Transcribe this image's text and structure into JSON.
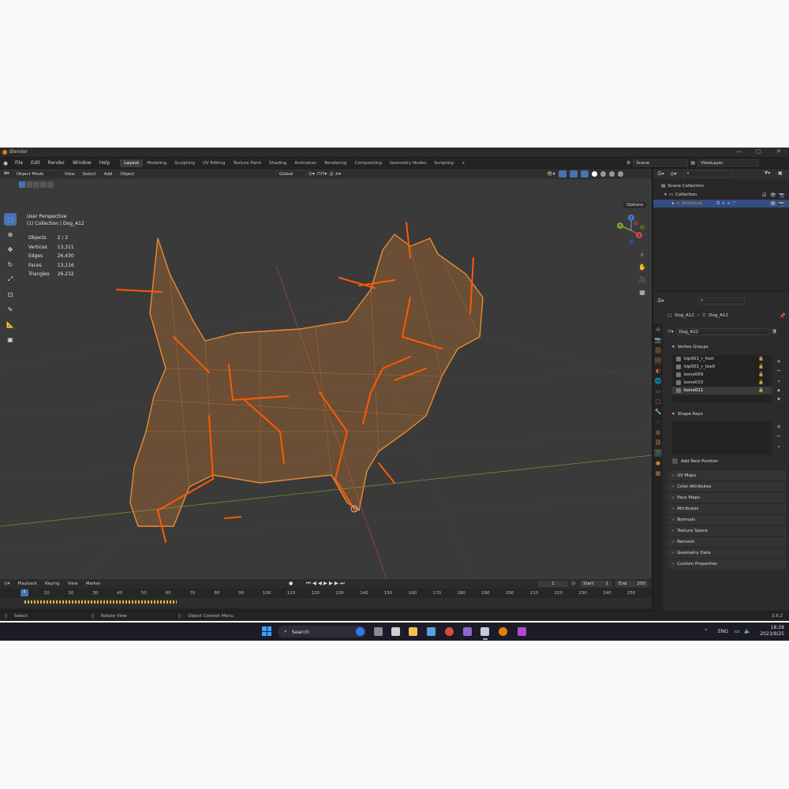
{
  "app": {
    "title": "Blender",
    "version": "3.6.2"
  },
  "menubar": {
    "menus": [
      "File",
      "Edit",
      "Render",
      "Window",
      "Help"
    ],
    "workspaces": [
      "Layout",
      "Modeling",
      "Sculpting",
      "UV Editing",
      "Texture Paint",
      "Shading",
      "Animation",
      "Rendering",
      "Compositing",
      "Geometry Nodes",
      "Scripting"
    ],
    "active_workspace": "Layout",
    "scene": "Scene",
    "view_layer": "ViewLayer"
  },
  "viewport": {
    "mode": "Object Mode",
    "menus": [
      "View",
      "Select",
      "Add",
      "Object"
    ],
    "transform_orientation": "Global",
    "options_label": "Options",
    "perspective": "User Perspective",
    "context": "(1) Collection | Dog_A12",
    "stats": [
      {
        "label": "Objects",
        "value": "2 / 2"
      },
      {
        "label": "Vertices",
        "value": "13,311"
      },
      {
        "label": "Edges",
        "value": "26,430"
      },
      {
        "label": "Faces",
        "value": "13,116"
      },
      {
        "label": "Triangles",
        "value": "26,232"
      }
    ],
    "gizmo": {
      "x": "X",
      "y": "Y",
      "z": "Z"
    }
  },
  "timeline": {
    "menus": [
      "Playback",
      "Keying",
      "View",
      "Marker"
    ],
    "current_frame": "1",
    "start_label": "Start",
    "start": "1",
    "end_label": "End",
    "end": "250",
    "ticks": [
      "1",
      "10",
      "20",
      "30",
      "40",
      "50",
      "60",
      "70",
      "80",
      "90",
      "100",
      "110",
      "120",
      "130",
      "140",
      "150",
      "160",
      "170",
      "180",
      "190",
      "200",
      "210",
      "220",
      "230",
      "240",
      "250"
    ]
  },
  "statusbar": {
    "select": "Select",
    "rotate": "Rotate View",
    "context_menu": "Object Context Menu",
    "version": "3.6.2"
  },
  "outliner": {
    "scene_collection": "Scene Collection",
    "collection": "Collection",
    "armature": "Armature"
  },
  "properties": {
    "object": "Dog_A12",
    "mesh": "Dog_A12",
    "data_name": "Dog_A12",
    "vertex_groups_title": "Vertex Groups",
    "vertex_groups": [
      "bip001_r_foot",
      "bip001_r_toe0",
      "bone009",
      "bone010",
      "bone011"
    ],
    "active_group": "bone011",
    "shape_keys_title": "Shape Keys",
    "add_rest_position": "Add Rest Position",
    "panels": [
      "UV Maps",
      "Color Attributes",
      "Face Maps",
      "Attributes",
      "Normals",
      "Texture Space",
      "Remesh",
      "Geometry Data",
      "Custom Properties"
    ]
  },
  "taskbar": {
    "search": "Search",
    "language": "ENG",
    "time": "18:28",
    "date": "2023/9/25"
  },
  "colors": {
    "accent": "#4772b3",
    "wireframe": "#e8862d",
    "bones": "#ff5a00"
  }
}
